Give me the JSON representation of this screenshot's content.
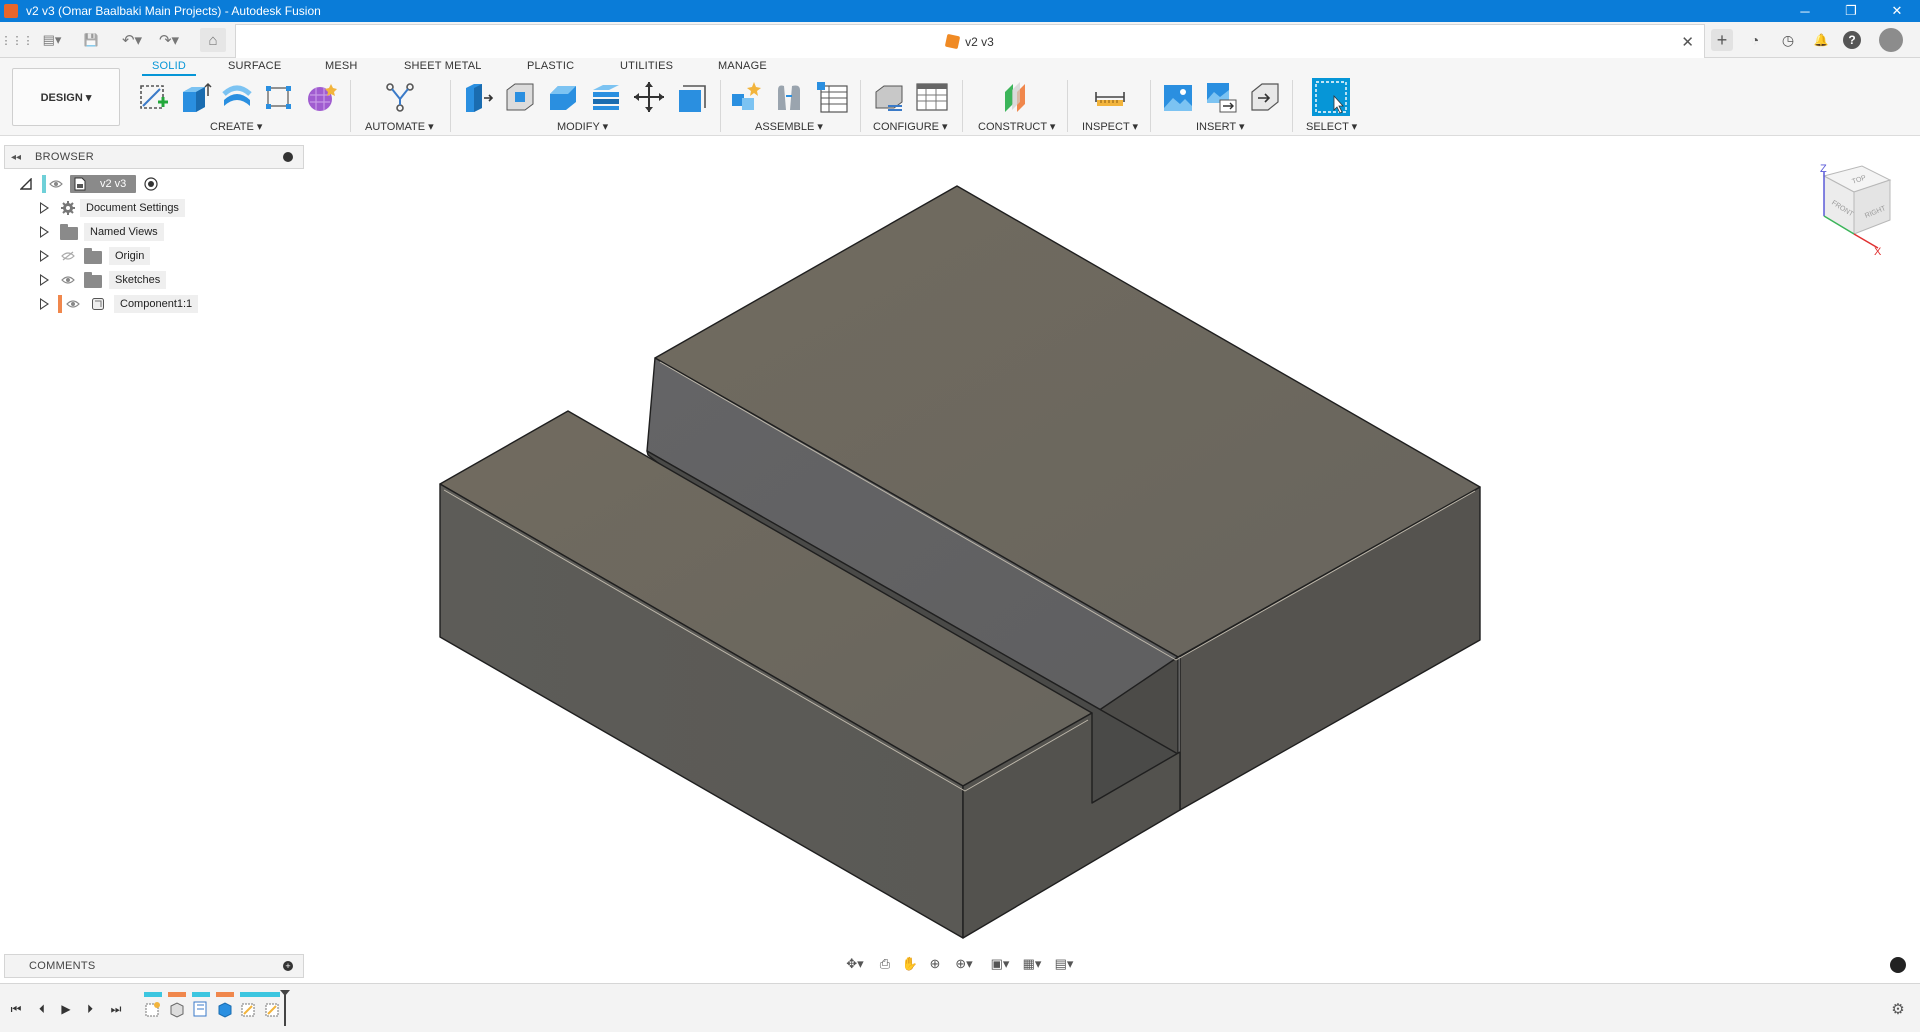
{
  "window": {
    "title": "v2 v3 (Omar Baalbaki Main Projects) - Autodesk Fusion",
    "minimize": "─",
    "maximize": "❐",
    "close": "✕"
  },
  "document_tab": {
    "label": "v2 v3",
    "close": "✕"
  },
  "quick_access": {
    "grid": "⋮⋮⋮",
    "file": "▤▾",
    "save": "💾",
    "undo": "↶▾",
    "redo": "↷▾",
    "home": "⌂",
    "new_tab": "+",
    "extensions": "◔",
    "job_status": "◷",
    "notifications": "🔔",
    "help": "?",
    "profile": "●"
  },
  "ribbon": {
    "tabs": [
      "SOLID",
      "SURFACE",
      "MESH",
      "SHEET METAL",
      "PLASTIC",
      "UTILITIES",
      "MANAGE"
    ],
    "active_tab": "SOLID",
    "workspace": "DESIGN ▾",
    "groups": {
      "create": "CREATE ▾",
      "automate": "AUTOMATE ▾",
      "modify": "MODIFY ▾",
      "assemble": "ASSEMBLE ▾",
      "configure": "CONFIGURE ▾",
      "construct": "CONSTRUCT ▾",
      "inspect": "INSPECT ▾",
      "insert": "INSERT ▾",
      "select": "SELECT ▾"
    }
  },
  "browser": {
    "title": "BROWSER",
    "collapse": "◂◂",
    "root": "v2 v3",
    "items": [
      {
        "label": "Document Settings"
      },
      {
        "label": "Named Views"
      },
      {
        "label": "Origin"
      },
      {
        "label": "Sketches"
      },
      {
        "label": "Component1:1"
      }
    ]
  },
  "comments": {
    "title": "COMMENTS",
    "add": "+"
  },
  "viewcube": {
    "top": "TOP",
    "front": "FRONT",
    "right": "RIGHT",
    "axis_z": "Z",
    "axis_x": "X"
  },
  "navbar": {
    "orbit": "✥▾",
    "look_at": "⎙",
    "pan": "✋",
    "zoom": "⊕",
    "fit": "⊕▾",
    "display": "▣▾",
    "grid": "▦▾",
    "viewports": "▤▾"
  },
  "timeline": {
    "first": "⏮",
    "prev": "⏴",
    "play": "▶",
    "next": "⏵",
    "last": "⏭",
    "settings": "⚙"
  },
  "colors": {
    "title_bar": "#0a7cd8",
    "accent": "#0696d7",
    "model_top": "#6f6a60",
    "model_side": "#56544f",
    "timeline_sketch": "#3cc6e0",
    "timeline_feature": "#f0874c"
  }
}
